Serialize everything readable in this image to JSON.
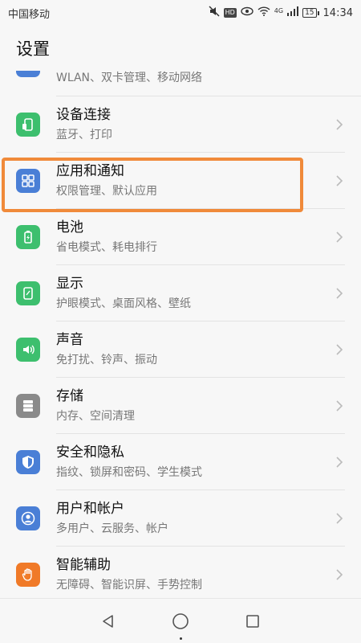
{
  "status_bar": {
    "carrier": "中国移动",
    "hd_badge": "HD",
    "network_type": "4G",
    "battery_level": "15",
    "time": "14:34",
    "icons": [
      "mute-icon",
      "hd-icon",
      "eye-comfort-icon",
      "wifi-icon",
      "signal-icon",
      "battery-icon"
    ]
  },
  "header": {
    "title": "设置"
  },
  "partial_item": {
    "subtitle": "WLAN、双卡管理、移动网络",
    "icon": "network-icon",
    "color": "#4a7fd6"
  },
  "settings": [
    {
      "title": "设备连接",
      "subtitle": "蓝牙、打印",
      "icon": "device-connect-icon",
      "color": "#3dbf6e"
    },
    {
      "title": "应用和通知",
      "subtitle": "权限管理、默认应用",
      "icon": "apps-icon",
      "color": "#4a7fd6"
    },
    {
      "title": "电池",
      "subtitle": "省电模式、耗电排行",
      "icon": "battery-setting-icon",
      "color": "#3dbf6e"
    },
    {
      "title": "显示",
      "subtitle": "护眼模式、桌面风格、壁纸",
      "icon": "display-icon",
      "color": "#3dbf6e"
    },
    {
      "title": "声音",
      "subtitle": "免打扰、铃声、振动",
      "icon": "sound-icon",
      "color": "#3dbf6e"
    },
    {
      "title": "存储",
      "subtitle": "内存、空间清理",
      "icon": "storage-icon",
      "color": "#8a8a8a"
    },
    {
      "title": "安全和隐私",
      "subtitle": "指纹、锁屏和密码、学生模式",
      "icon": "shield-icon",
      "color": "#4a7fd6"
    },
    {
      "title": "用户和帐户",
      "subtitle": "多用户、云服务、帐户",
      "icon": "user-icon",
      "color": "#4a7fd6"
    },
    {
      "title": "智能辅助",
      "subtitle": "无障碍、智能识屏、手势控制",
      "icon": "hand-icon",
      "color": "#f07a28"
    }
  ],
  "highlight_color": "#f08a3a",
  "nav_bar": {
    "buttons": [
      "back-icon",
      "home-icon",
      "recents-icon"
    ]
  }
}
